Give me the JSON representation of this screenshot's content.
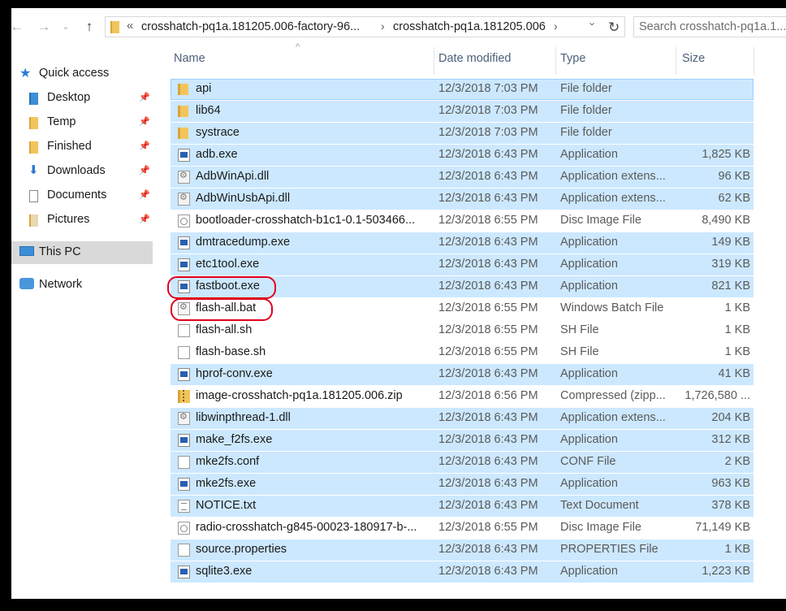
{
  "nav": {
    "back_icon": "arrow-left-icon",
    "forward_icon": "arrow-right-icon",
    "recent_icon": "chevron-down-icon",
    "up_icon": "arrow-up-icon"
  },
  "address": {
    "overflow": "«",
    "crumbs": [
      "crosshatch-pq1a.181205.006-factory-96...",
      "crosshatch-pq1a.181205.006"
    ],
    "separator": "›",
    "refresh_icon": "refresh-icon"
  },
  "search": {
    "placeholder": "Search crosshatch-pq1a.1..."
  },
  "navpane": {
    "items": [
      {
        "label": "Quick access",
        "icon": "star-icon"
      },
      {
        "label": "Desktop",
        "icon": "desktop-folder-icon",
        "pinned": true
      },
      {
        "label": "Temp",
        "icon": "folder-icon",
        "pinned": true
      },
      {
        "label": "Finished",
        "icon": "folder-icon",
        "pinned": true
      },
      {
        "label": "Downloads",
        "icon": "downloads-icon",
        "pinned": true
      },
      {
        "label": "Documents",
        "icon": "documents-icon",
        "pinned": true
      },
      {
        "label": "Pictures",
        "icon": "pictures-icon",
        "pinned": true
      },
      {
        "label": "This PC",
        "icon": "computer-icon",
        "selected": true
      },
      {
        "label": "Network",
        "icon": "network-icon"
      }
    ]
  },
  "columns": {
    "name": "Name",
    "date": "Date modified",
    "type": "Type",
    "size": "Size"
  },
  "files": [
    {
      "name": "api",
      "date": "12/3/2018 7:03 PM",
      "type": "File folder",
      "size": "",
      "icon": "folder",
      "selected": true
    },
    {
      "name": "lib64",
      "date": "12/3/2018 7:03 PM",
      "type": "File folder",
      "size": "",
      "icon": "folder",
      "selected": true
    },
    {
      "name": "systrace",
      "date": "12/3/2018 7:03 PM",
      "type": "File folder",
      "size": "",
      "icon": "folder",
      "selected": true
    },
    {
      "name": "adb.exe",
      "date": "12/3/2018 6:43 PM",
      "type": "Application",
      "size": "1,825 KB",
      "icon": "app",
      "selected": true
    },
    {
      "name": "AdbWinApi.dll",
      "date": "12/3/2018 6:43 PM",
      "type": "Application extens...",
      "size": "96 KB",
      "icon": "dll",
      "selected": true
    },
    {
      "name": "AdbWinUsbApi.dll",
      "date": "12/3/2018 6:43 PM",
      "type": "Application extens...",
      "size": "62 KB",
      "icon": "dll",
      "selected": true
    },
    {
      "name": "bootloader-crosshatch-b1c1-0.1-503466...",
      "date": "12/3/2018 6:55 PM",
      "type": "Disc Image File",
      "size": "8,490 KB",
      "icon": "disc",
      "selected": false
    },
    {
      "name": "dmtracedump.exe",
      "date": "12/3/2018 6:43 PM",
      "type": "Application",
      "size": "149 KB",
      "icon": "app",
      "selected": true
    },
    {
      "name": "etc1tool.exe",
      "date": "12/3/2018 6:43 PM",
      "type": "Application",
      "size": "319 KB",
      "icon": "app",
      "selected": true
    },
    {
      "name": "fastboot.exe",
      "date": "12/3/2018 6:43 PM",
      "type": "Application",
      "size": "821 KB",
      "icon": "app",
      "selected": true
    },
    {
      "name": "flash-all.bat",
      "date": "12/3/2018 6:55 PM",
      "type": "Windows Batch File",
      "size": "1 KB",
      "icon": "bat",
      "selected": false
    },
    {
      "name": "flash-all.sh",
      "date": "12/3/2018 6:55 PM",
      "type": "SH File",
      "size": "1 KB",
      "icon": "doc",
      "selected": false
    },
    {
      "name": "flash-base.sh",
      "date": "12/3/2018 6:55 PM",
      "type": "SH File",
      "size": "1 KB",
      "icon": "doc",
      "selected": false
    },
    {
      "name": "hprof-conv.exe",
      "date": "12/3/2018 6:43 PM",
      "type": "Application",
      "size": "41 KB",
      "icon": "app",
      "selected": true
    },
    {
      "name": "image-crosshatch-pq1a.181205.006.zip",
      "date": "12/3/2018 6:56 PM",
      "type": "Compressed (zipp...",
      "size": "1,726,580 ...",
      "icon": "zip",
      "selected": false
    },
    {
      "name": "libwinpthread-1.dll",
      "date": "12/3/2018 6:43 PM",
      "type": "Application extens...",
      "size": "204 KB",
      "icon": "dll",
      "selected": true
    },
    {
      "name": "make_f2fs.exe",
      "date": "12/3/2018 6:43 PM",
      "type": "Application",
      "size": "312 KB",
      "icon": "app",
      "selected": true
    },
    {
      "name": "mke2fs.conf",
      "date": "12/3/2018 6:43 PM",
      "type": "CONF File",
      "size": "2 KB",
      "icon": "doc",
      "selected": true
    },
    {
      "name": "mke2fs.exe",
      "date": "12/3/2018 6:43 PM",
      "type": "Application",
      "size": "963 KB",
      "icon": "app",
      "selected": true
    },
    {
      "name": "NOTICE.txt",
      "date": "12/3/2018 6:43 PM",
      "type": "Text Document",
      "size": "378 KB",
      "icon": "txt",
      "selected": true
    },
    {
      "name": "radio-crosshatch-g845-00023-180917-b-...",
      "date": "12/3/2018 6:55 PM",
      "type": "Disc Image File",
      "size": "71,149 KB",
      "icon": "disc",
      "selected": false
    },
    {
      "name": "source.properties",
      "date": "12/3/2018 6:43 PM",
      "type": "PROPERTIES File",
      "size": "1 KB",
      "icon": "doc",
      "selected": true
    },
    {
      "name": "sqlite3.exe",
      "date": "12/3/2018 6:43 PM",
      "type": "Application",
      "size": "1,223 KB",
      "icon": "app",
      "selected": true
    }
  ],
  "annotations": {
    "highlight_color": "#e0001b",
    "highlighted": [
      "fastboot.exe",
      "flash-all.bat"
    ]
  }
}
